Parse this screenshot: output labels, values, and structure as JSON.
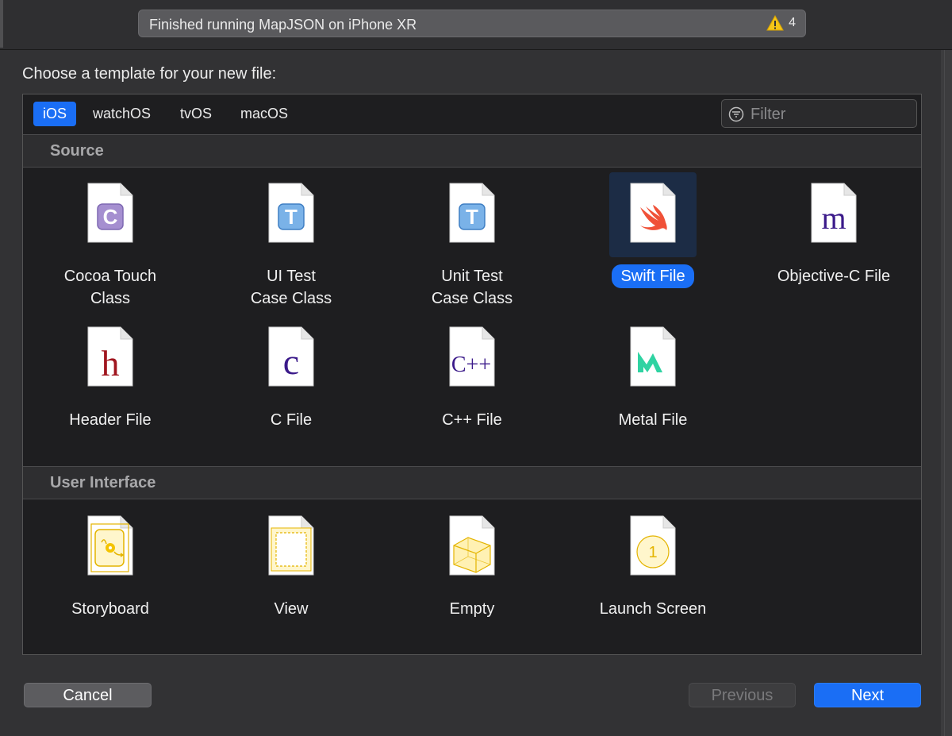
{
  "toolbar": {
    "status_text": "Finished running MapJSON on iPhone XR",
    "warning_count": "4"
  },
  "dialog": {
    "prompt": "Choose a template for your new file:",
    "tabs": [
      {
        "label": "iOS",
        "selected": true
      },
      {
        "label": "watchOS",
        "selected": false
      },
      {
        "label": "tvOS",
        "selected": false
      },
      {
        "label": "macOS",
        "selected": false
      }
    ],
    "filter_placeholder": "Filter",
    "sections": [
      {
        "title": "Source",
        "items": [
          {
            "line1": "Cocoa Touch",
            "line2": "Class",
            "icon": "cocoa-touch-class-icon"
          },
          {
            "line1": "UI Test",
            "line2": "Case Class",
            "icon": "ui-test-case-icon"
          },
          {
            "line1": "Unit Test",
            "line2": "Case Class",
            "icon": "unit-test-case-icon"
          },
          {
            "line1": "Swift File",
            "line2": "",
            "icon": "swift-icon",
            "selected": true
          },
          {
            "line1": "Objective-C File",
            "line2": "",
            "icon": "objective-c-icon"
          },
          {
            "line1": "Header File",
            "line2": "",
            "icon": "header-file-icon"
          },
          {
            "line1": "C File",
            "line2": "",
            "icon": "c-file-icon"
          },
          {
            "line1": "C++ File",
            "line2": "",
            "icon": "cpp-file-icon"
          },
          {
            "line1": "Metal File",
            "line2": "",
            "icon": "metal-icon"
          }
        ]
      },
      {
        "title": "User Interface",
        "items": [
          {
            "line1": "Storyboard",
            "line2": "",
            "icon": "storyboard-icon"
          },
          {
            "line1": "View",
            "line2": "",
            "icon": "view-icon"
          },
          {
            "line1": "Empty",
            "line2": "",
            "icon": "empty-icon"
          },
          {
            "line1": "Launch Screen",
            "line2": "",
            "icon": "launch-screen-icon"
          }
        ]
      }
    ],
    "glyphs": {
      "cocoa": "C",
      "test": "T",
      "objc": "m",
      "header": "h",
      "c": "c",
      "cpp": "C++",
      "launch": "1"
    },
    "buttons": {
      "cancel": "Cancel",
      "previous": "Previous",
      "next": "Next"
    },
    "colors": {
      "accent": "#1a6ef5",
      "selection_bg": "#1c2c45"
    }
  }
}
